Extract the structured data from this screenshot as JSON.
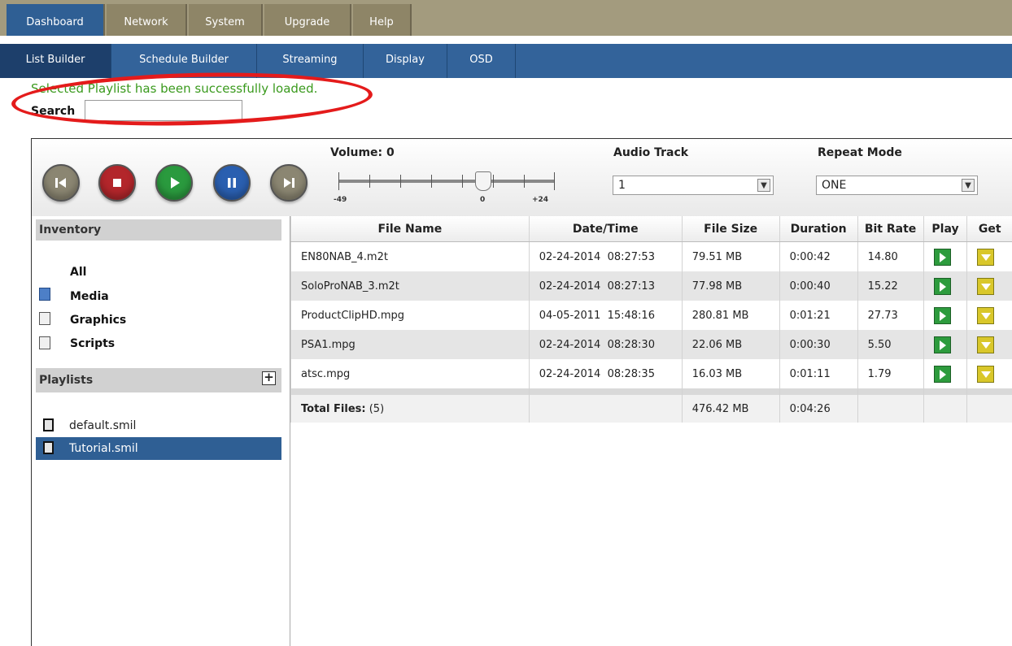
{
  "top_nav": [
    "Dashboard",
    "Network",
    "System",
    "Upgrade",
    "Help"
  ],
  "sub_nav": [
    "List Builder",
    "Schedule Builder",
    "Streaming",
    "Display",
    "OSD"
  ],
  "status_message": "Selected Playlist has been successfully loaded.",
  "search": {
    "label": "Search",
    "value": ""
  },
  "player": {
    "controls": [
      "previous-icon",
      "stop-icon",
      "play-icon",
      "pause-icon",
      "next-icon"
    ],
    "volume_label": "Volume: 0",
    "volume_min": "-49",
    "volume_mid": "0",
    "volume_max": "+24",
    "audio_track_label": "Audio Track",
    "audio_track_value": "1",
    "repeat_mode_label": "Repeat Mode",
    "repeat_mode_value": "ONE"
  },
  "inventory": {
    "title": "Inventory",
    "items": [
      "All",
      "Media",
      "Graphics",
      "Scripts"
    ]
  },
  "playlists": {
    "title": "Playlists",
    "items": [
      "default.smil",
      "Tutorial.smil"
    ],
    "selected": "Tutorial.smil"
  },
  "table": {
    "headers": [
      "File Name",
      "Date/Time",
      "File Size",
      "Duration",
      "Bit Rate",
      "Play",
      "Get"
    ],
    "rows": [
      {
        "name": "EN80NAB_4.m2t",
        "datetime": "02-24-2014  08:27:53",
        "size": "79.51 MB",
        "duration": "0:00:42",
        "bitrate": "14.80"
      },
      {
        "name": "SoloProNAB_3.m2t",
        "datetime": "02-24-2014  08:27:13",
        "size": "77.98 MB",
        "duration": "0:00:40",
        "bitrate": "15.22"
      },
      {
        "name": "ProductClipHD.mpg",
        "datetime": "04-05-2011  15:48:16",
        "size": "280.81 MB",
        "duration": "0:01:21",
        "bitrate": "27.73"
      },
      {
        "name": "PSA1.mpg",
        "datetime": "02-24-2014  08:28:30",
        "size": "22.06 MB",
        "duration": "0:00:30",
        "bitrate": "5.50"
      },
      {
        "name": "atsc.mpg",
        "datetime": "02-24-2014  08:28:35",
        "size": "16.03 MB",
        "duration": "0:01:11",
        "bitrate": "1.79"
      }
    ],
    "total_label": "Total Files:",
    "total_count": "(5)",
    "total_size": "476.42 MB",
    "total_duration": "0:04:26"
  },
  "colors": {
    "nav_active": "#2f5f94",
    "subnav": "#33639a",
    "status_green": "#3a9a1d",
    "highlight_ring": "#e41b1b"
  }
}
